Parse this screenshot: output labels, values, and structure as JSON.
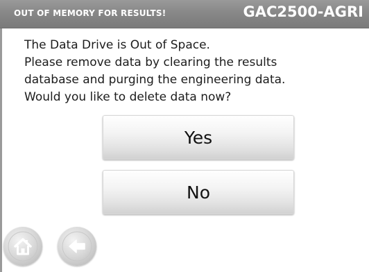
{
  "titlebar": {
    "alert_text": "OUT OF MEMORY FOR RESULTS!",
    "device_name": "GAC2500-AGRI"
  },
  "message": {
    "lines": [
      "The Data Drive is Out of Space.",
      "Please remove data by clearing the results",
      "database and purging the engineering data.",
      "Would you like to delete data now?"
    ]
  },
  "buttons": {
    "yes_label": "Yes",
    "no_label": "No"
  },
  "nav": {
    "home_icon": "home-icon",
    "back_icon": "back-arrow-icon"
  },
  "colors": {
    "titlebar_bg": "#888888",
    "titlebar_text": "#ffffff",
    "body_text": "#1c1c1c"
  }
}
